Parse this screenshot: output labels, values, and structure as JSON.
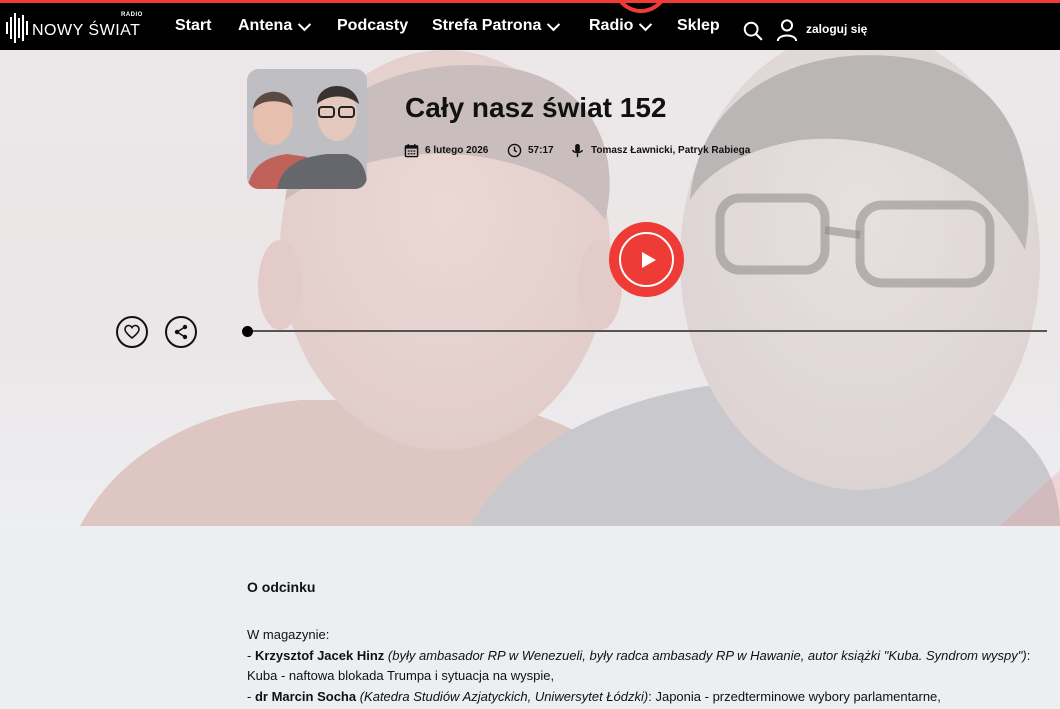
{
  "brand": {
    "name": "NOWY ŚWIAT",
    "sub": "RADIO"
  },
  "nav": {
    "items": [
      {
        "label": "Start",
        "dropdown": false
      },
      {
        "label": "Antena",
        "dropdown": true
      },
      {
        "label": "Podcasty",
        "dropdown": false
      },
      {
        "label": "Strefa Patrona",
        "dropdown": true
      },
      {
        "label": "Radio",
        "dropdown": true
      },
      {
        "label": "Sklep",
        "dropdown": false
      }
    ],
    "search_icon": "search-icon",
    "user_icon": "user-icon",
    "login_label": "zaloguj się"
  },
  "episode": {
    "title": "Cały nasz świat 152",
    "date": "6 lutego 2026",
    "duration": "57:17",
    "hosts": "Tomasz Ławnicki, Patryk Rabiega",
    "progress": 0
  },
  "about": {
    "title": "O odcinku",
    "intro": "W magazynie:",
    "items": [
      {
        "prefix": "- ",
        "name": "Krzysztof Jacek Hinz",
        "role": "(były ambasador RP w Wenezueli, były radca ambasady RP w Hawanie, autor książki \"Kuba. Syndrom wyspy\")",
        "topic": ": Kuba - naftowa blokada Trumpa i sytuacja na wyspie,"
      },
      {
        "prefix": "- ",
        "name": "dr Marcin Socha",
        "role": "(Katedra Studiów Azjatyckich, Uniwersytet Łódzki)",
        "topic": ": Japonia - przedterminowe wybory parlamentarne,"
      }
    ]
  },
  "colors": {
    "accent": "#ef3b36",
    "nav_bg": "#000000",
    "page_bg": "#eceef2"
  }
}
